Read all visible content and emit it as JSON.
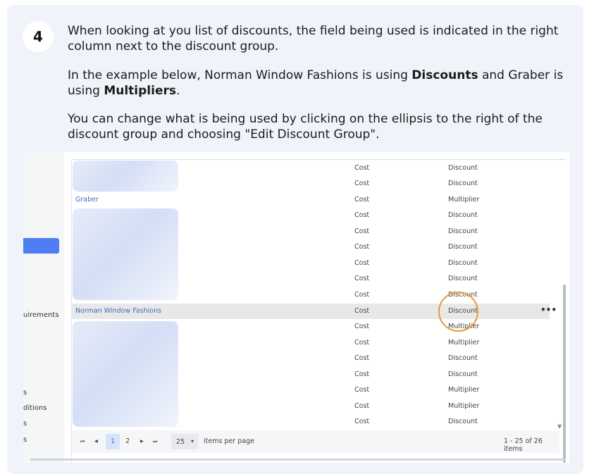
{
  "step": {
    "number": "4"
  },
  "instructions": {
    "p1": "When looking at you list of discounts, the field being used is indicated in the right column next to the discount group.",
    "p2": {
      "before": "In the example below, Norman Window Fashions is using ",
      "bold1": "Discounts",
      "middle": " and Graber is using ",
      "bold2": "Multipliers",
      "after": "."
    },
    "p3": "You can change what is being used by clicking on the ellipsis to the right of the discount group and choosing \"Edit Discount Group\"."
  },
  "sidebar": {
    "labels": [
      "uirements",
      "s",
      "ditions",
      "s",
      "s"
    ]
  },
  "table": {
    "rows": [
      {
        "name": "",
        "cost": "Cost",
        "type": "Discount"
      },
      {
        "name": "",
        "cost": "Cost",
        "type": "Discount"
      },
      {
        "name": "Graber",
        "cost": "Cost",
        "type": "Multiplier"
      },
      {
        "name": "",
        "cost": "Cost",
        "type": "Discount"
      },
      {
        "name": "",
        "cost": "Cost",
        "type": "Discount"
      },
      {
        "name": "",
        "cost": "Cost",
        "type": "Discount"
      },
      {
        "name": "",
        "cost": "Cost",
        "type": "Discount"
      },
      {
        "name": "",
        "cost": "Cost",
        "type": "Discount"
      },
      {
        "name": "",
        "cost": "Cost",
        "type": "Discount"
      },
      {
        "name": "Norman Window Fashions",
        "cost": "Cost",
        "type": "Discount",
        "menu": "•••"
      },
      {
        "name": "",
        "cost": "Cost",
        "type": "Multiplier"
      },
      {
        "name": "",
        "cost": "Cost",
        "type": "Multiplier"
      },
      {
        "name": "",
        "cost": "Cost",
        "type": "Discount"
      },
      {
        "name": "",
        "cost": "Cost",
        "type": "Discount"
      },
      {
        "name": "",
        "cost": "Cost",
        "type": "Multiplier"
      },
      {
        "name": "",
        "cost": "Cost",
        "type": "Multiplier"
      },
      {
        "name": "",
        "cost": "Cost",
        "type": "Discount"
      }
    ]
  },
  "pager": {
    "first": "⏮",
    "prev": "◂",
    "page1": "1",
    "page2": "2",
    "next": "▸",
    "last": "⏭",
    "per_page_value": "25",
    "per_page_caret": "▾",
    "per_page_label": "items per page",
    "summary": "1 - 25 of 26 items"
  },
  "colors": {
    "accent": "#4f7df3",
    "link": "#3b6fb6",
    "highlight_ring": "#e9993b"
  }
}
